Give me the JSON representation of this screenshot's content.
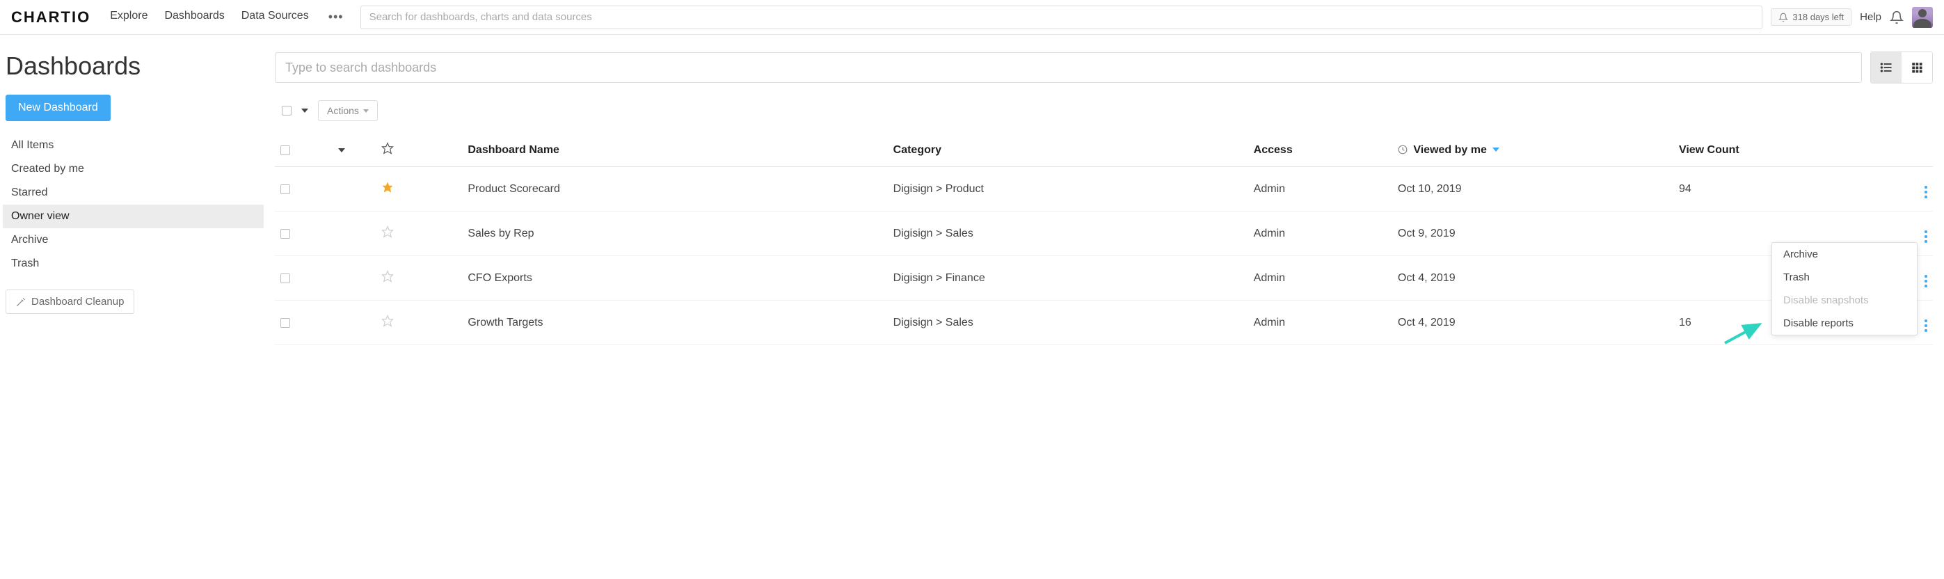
{
  "topbar": {
    "logo": "CHARTIO",
    "nav": {
      "explore": "Explore",
      "dashboards": "Dashboards",
      "datasources": "Data Sources"
    },
    "search_placeholder": "Search for dashboards, charts and data sources",
    "days_left": "318 days left",
    "help": "Help"
  },
  "sidebar": {
    "title": "Dashboards",
    "new_btn": "New Dashboard",
    "items": {
      "all": "All Items",
      "created": "Created by me",
      "starred": "Starred",
      "owner": "Owner view",
      "archive": "Archive",
      "trash": "Trash"
    },
    "cleanup": "Dashboard Cleanup"
  },
  "main": {
    "search_placeholder": "Type to search dashboards",
    "actions_label": "Actions",
    "columns": {
      "name": "Dashboard Name",
      "category": "Category",
      "access": "Access",
      "viewed": "Viewed by me",
      "view_count": "View Count"
    },
    "rows": [
      {
        "starred": true,
        "name": "Product Scorecard",
        "category": "Digisign > Product",
        "access": "Admin",
        "viewed": "Oct 10, 2019",
        "view_count": "94"
      },
      {
        "starred": false,
        "name": "Sales by Rep",
        "category": "Digisign > Sales",
        "access": "Admin",
        "viewed": "Oct 9, 2019",
        "view_count": ""
      },
      {
        "starred": false,
        "name": "CFO Exports",
        "category": "Digisign > Finance",
        "access": "Admin",
        "viewed": "Oct 4, 2019",
        "view_count": ""
      },
      {
        "starred": false,
        "name": "Growth Targets",
        "category": "Digisign > Sales",
        "access": "Admin",
        "viewed": "Oct 4, 2019",
        "view_count": "16"
      }
    ]
  },
  "dropdown": {
    "archive": "Archive",
    "trash": "Trash",
    "disable_snapshots": "Disable snapshots",
    "disable_reports": "Disable reports"
  }
}
